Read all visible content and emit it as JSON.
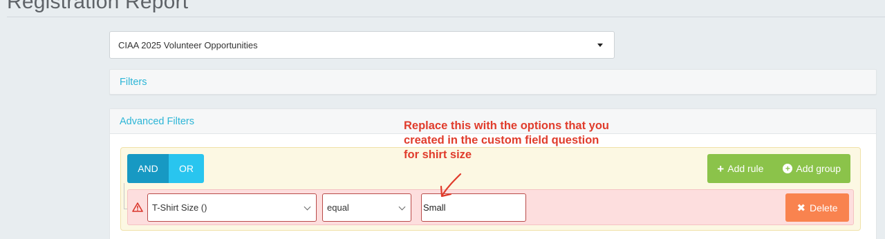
{
  "page": {
    "title": "Registration Report"
  },
  "report_select": {
    "value": "CIAA 2025 Volunteer Opportunities"
  },
  "filters_panel": {
    "heading": "Filters"
  },
  "advanced_filters": {
    "heading": "Advanced Filters",
    "condition_and": "AND",
    "condition_or": "OR",
    "add_rule_label": "Add rule",
    "add_group_label": "Add group",
    "rule": {
      "field": "T-Shirt Size ()",
      "operator": "equal",
      "value": "Small",
      "delete_label": "Delete"
    }
  },
  "annotation": {
    "lines": [
      "Replace this with the options that you",
      "created in the custom field question",
      "for shirt size"
    ]
  },
  "colors": {
    "accent": "#2cb5d6",
    "and_button": "#1799c3",
    "or_button": "#29c5ef",
    "add_buttons": "#8bc34a",
    "delete_button": "#f9834f",
    "error_row": "#fddede",
    "annotation": "#e03c2c"
  },
  "icons": {
    "select_caret": "caret-down-icon",
    "add_rule": "plus-icon",
    "add_group": "circle-plus-icon",
    "rule_warning": "warning-icon",
    "delete": "times-icon",
    "annotation_pointer": "arrow-icon"
  }
}
